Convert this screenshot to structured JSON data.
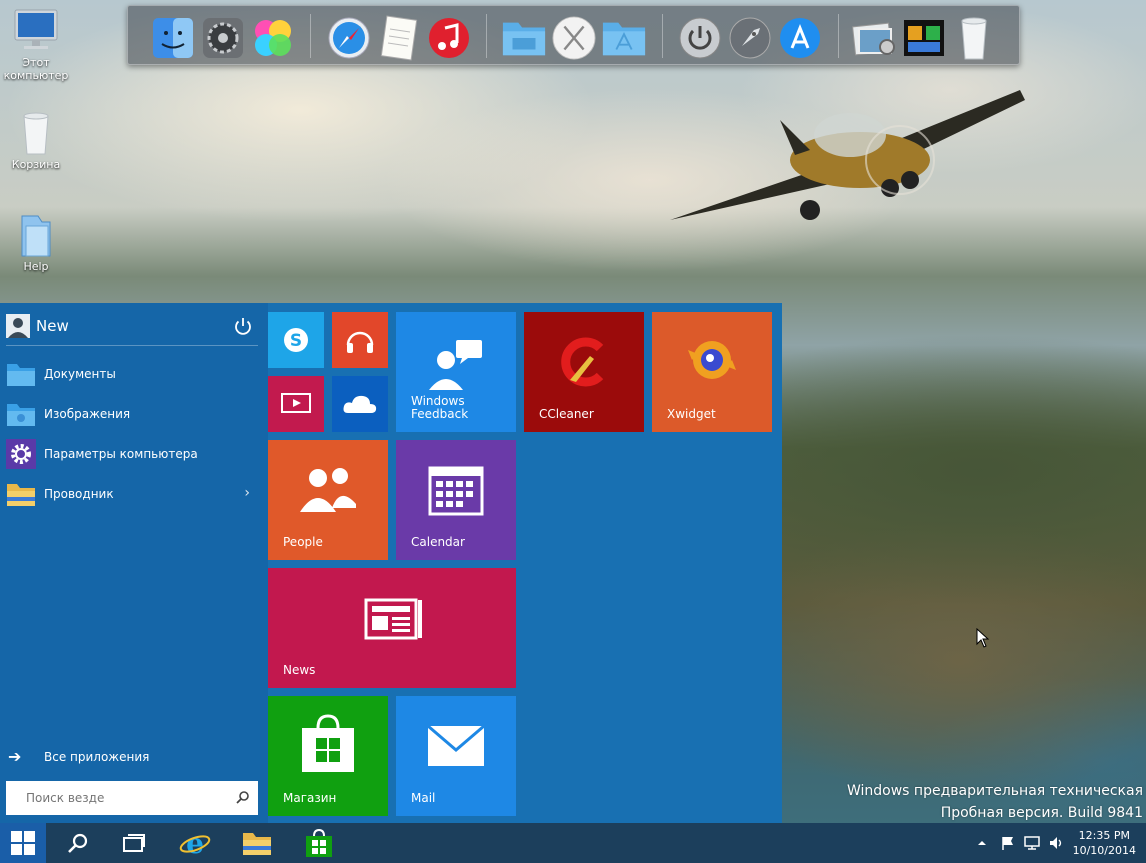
{
  "desktop": {
    "icons": [
      {
        "label": "Этот\nкомпьютер"
      },
      {
        "label": "Корзина"
      },
      {
        "label": "Help"
      }
    ]
  },
  "dock": {
    "items": [
      "finder-icon",
      "system-preferences-icon",
      "game-center-icon",
      "safari-icon",
      "notes-icon",
      "itunes-icon",
      "folder-icon",
      "osx-icon",
      "applications-folder-icon",
      "power-icon",
      "launchpad-icon",
      "app-store-icon",
      "photo-viewer-icon",
      "desktop-icon",
      "trash-icon"
    ]
  },
  "start_menu": {
    "user_name": "New",
    "items": [
      {
        "label": "Документы",
        "icon": "folder-icon"
      },
      {
        "label": "Изображения",
        "icon": "folder-icon"
      },
      {
        "label": "Параметры компьютера",
        "icon": "gear-icon"
      },
      {
        "label": "Проводник",
        "icon": "explorer-icon"
      }
    ],
    "all_apps": "Все приложения",
    "search_placeholder": "Поиск везде",
    "tiles": {
      "windows_feedback": "Windows\nFeedback",
      "ccleaner": "CCleaner",
      "xwidget": "Xwidget",
      "people": "People",
      "calendar": "Calendar",
      "news": "News",
      "store": "Магазин",
      "mail": "Mail"
    }
  },
  "watermark": {
    "line1": "Windows предварительная техническая",
    "line2": "Пробная версия. Build 9841"
  },
  "taskbar": {
    "time": "12:35 PM",
    "date": "10/10/2014"
  },
  "colors": {
    "start_bg": "#1870b2",
    "tile_blue": "#1e88e5",
    "ccleaner": "#9b0b0b",
    "xwidget": "#dc5a2a",
    "people": "#e0592a",
    "calendar": "#6a3aa8",
    "news": "#c2184e",
    "store": "#10a010",
    "taskbar": "#1c3f5c"
  }
}
